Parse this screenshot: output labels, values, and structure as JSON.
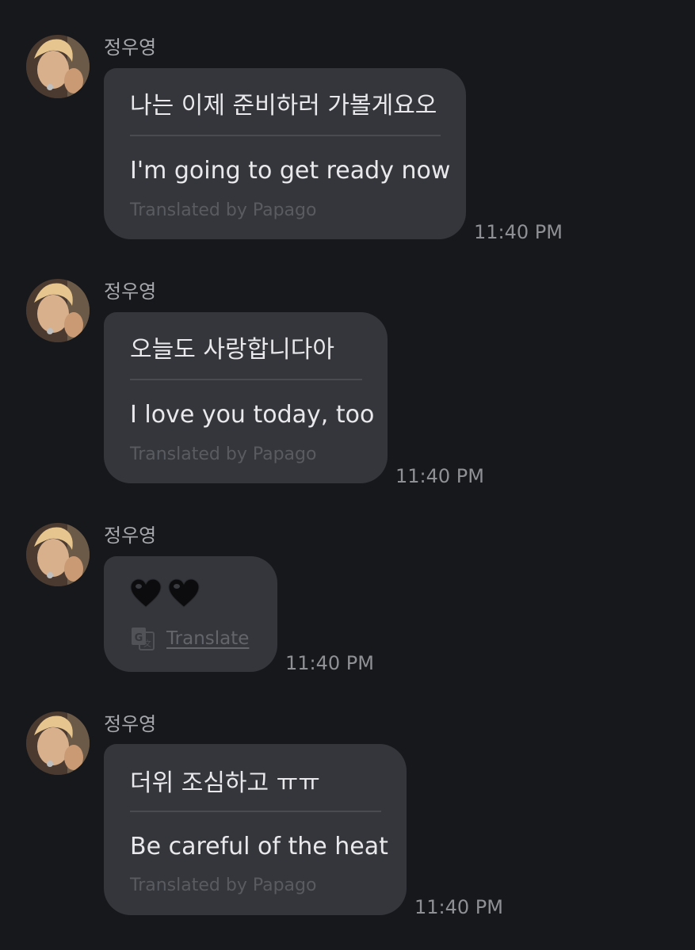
{
  "messages": [
    {
      "sender": "정우영",
      "original": "나는 이제 준비하러 가볼게요오",
      "translation": "I'm going to get ready now",
      "translated_by": "Translated by Papago",
      "time": "11:40 PM"
    },
    {
      "sender": "정우영",
      "original": "오늘도 사랑합니다아",
      "translation": "I love you today, too",
      "translated_by": "Translated by Papago",
      "time": "11:40 PM"
    },
    {
      "sender": "정우영",
      "emoji_message": "black-heart-icon black-heart-icon",
      "translate_label": "Translate",
      "time": "11:40 PM"
    },
    {
      "sender": "정우영",
      "original": "더위 조심하고 ㅠㅠ",
      "translation": "Be careful of the heat",
      "translated_by": "Translated by Papago",
      "time": "11:40 PM"
    }
  ],
  "colors": {
    "background": "#17181c",
    "bubble": "#34363c",
    "text": "#e9e9eb",
    "muted": "#8f9095"
  }
}
